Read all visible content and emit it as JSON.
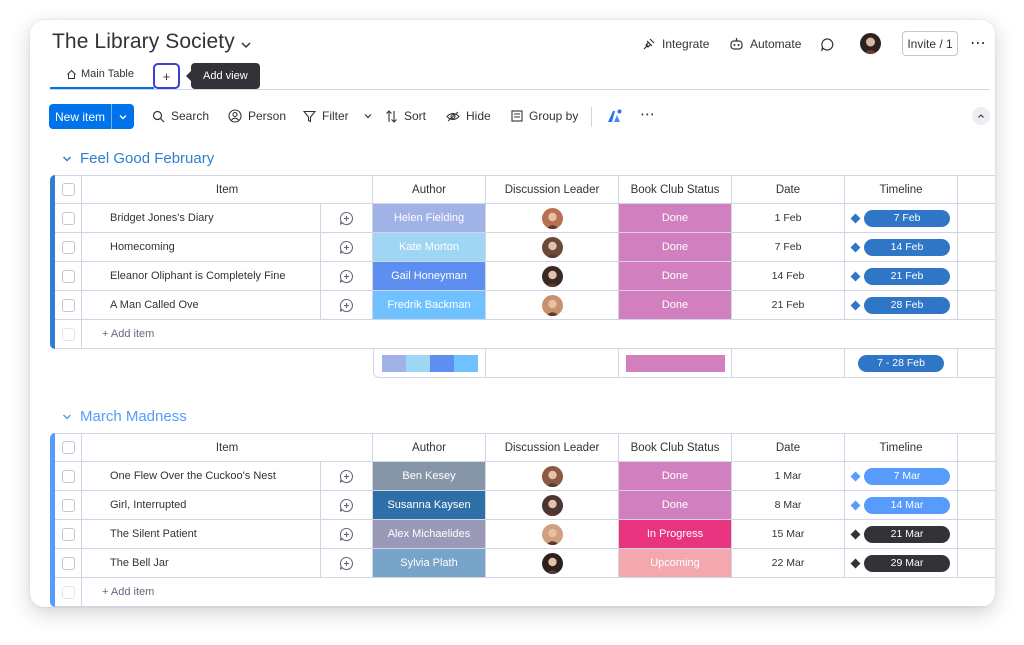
{
  "board": {
    "title": "The Library Society"
  },
  "header": {
    "integrate": "Integrate",
    "automate": "Automate",
    "invite": "Invite / 1"
  },
  "tabs": {
    "main": "Main Table",
    "add": "+",
    "tooltip": "Add view"
  },
  "toolbar": {
    "new_item": "New item",
    "search": "Search",
    "person": "Person",
    "filter": "Filter",
    "sort": "Sort",
    "hide": "Hide",
    "group_by": "Group by"
  },
  "columns": {
    "item": "Item",
    "author": "Author",
    "leader": "Discussion Leader",
    "status": "Book Club Status",
    "date": "Date",
    "timeline": "Timeline"
  },
  "groups": [
    {
      "title": "Feel Good February",
      "color": "#2e7fd1",
      "add_item": "+ Add item",
      "summary_timeline": "7 - 28 Feb",
      "rows": [
        {
          "item": "Bridget Jones's Diary",
          "author": "Helen Fielding",
          "author_color": "#a1b2e6",
          "status": "Done",
          "status_color": "#d27fbf",
          "date": "1 Feb",
          "timeline": "7 Feb",
          "tl_color": "#2f76c6"
        },
        {
          "item": "Homecoming",
          "author": "Kate Morton",
          "author_color": "#9fd6f4",
          "status": "Done",
          "status_color": "#d27fbf",
          "date": "7 Feb",
          "timeline": "14 Feb",
          "tl_color": "#2f76c6"
        },
        {
          "item": "Eleanor Oliphant is Completely Fine",
          "author": "Gail Honeyman",
          "author_color": "#5c8ff0",
          "status": "Done",
          "status_color": "#d27fbf",
          "date": "14 Feb",
          "timeline": "21 Feb",
          "tl_color": "#2f76c6"
        },
        {
          "item": "A Man Called Ove",
          "author": "Fredrik Backman",
          "author_color": "#6fc2ff",
          "status": "Done",
          "status_color": "#d27fbf",
          "date": "21 Feb",
          "timeline": "28 Feb",
          "tl_color": "#2f76c6"
        }
      ]
    },
    {
      "title": "March Madness",
      "color": "#579bfc",
      "add_item": "+ Add item",
      "rows": [
        {
          "item": "One Flew Over the Cuckoo's Nest",
          "author": "Ben Kesey",
          "author_color": "#8696a8",
          "status": "Done",
          "status_color": "#d27fbf",
          "date": "1 Mar",
          "timeline": "7 Mar",
          "tl_color": "#579bfc"
        },
        {
          "item": "Girl, Interrupted",
          "author": "Susanna Kaysen",
          "author_color": "#2f6fa8",
          "status": "Done",
          "status_color": "#d27fbf",
          "date": "8 Mar",
          "timeline": "14 Mar",
          "tl_color": "#579bfc"
        },
        {
          "item": "The Silent Patient",
          "author": "Alex Michaelides",
          "author_color": "#9a9ab8",
          "status": "In Progress",
          "status_color": "#e8337f",
          "date": "15 Mar",
          "timeline": "21 Mar",
          "tl_color": "#323338"
        },
        {
          "item": "The Bell Jar",
          "author": "Sylvia Plath",
          "author_color": "#77a4c8",
          "status": "Upcoming",
          "status_color": "#f2a8ac",
          "date": "22 Mar",
          "timeline": "29 Mar",
          "tl_color": "#323338"
        }
      ]
    }
  ]
}
